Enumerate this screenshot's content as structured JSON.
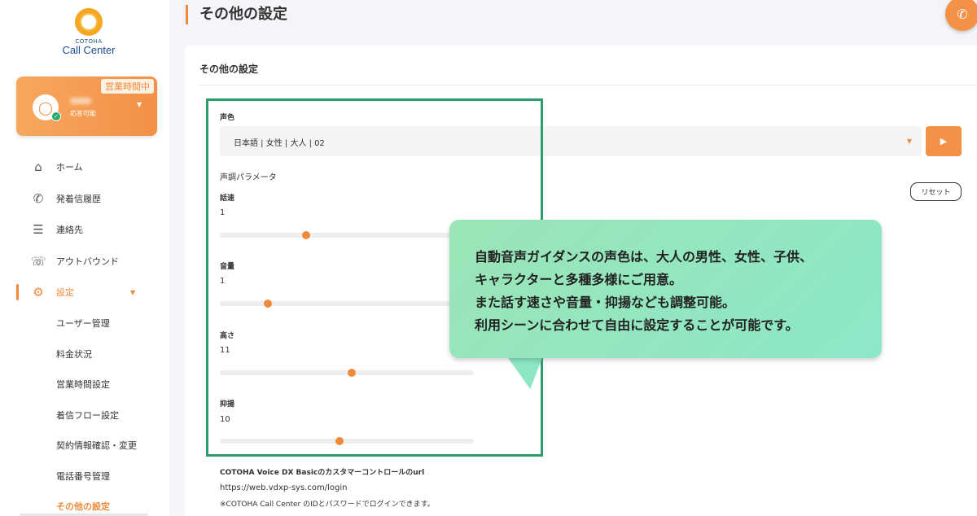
{
  "sidebar": {
    "logo": {
      "small": "COTOHA",
      "big": "Call Center"
    },
    "user": {
      "status_tag": "営業時間中",
      "availability": "応答可能"
    },
    "nav": [
      {
        "label": "ホーム",
        "icon": "home-icon"
      },
      {
        "label": "発着信履歴",
        "icon": "phone-history-icon"
      },
      {
        "label": "連絡先",
        "icon": "contacts-icon"
      },
      {
        "label": "アウトバウンド",
        "icon": "outbound-icon"
      },
      {
        "label": "設定",
        "icon": "gear-icon"
      }
    ],
    "settings_sub": [
      "ユーザー管理",
      "料金状況",
      "営業時間設定",
      "着信フロー設定",
      "契約情報確認・変更",
      "電話番号管理",
      "その他の設定"
    ]
  },
  "header": {
    "title": "その他の設定"
  },
  "card": {
    "title": "その他の設定",
    "voice_label": "声色",
    "voice_value": "日本語 | 女性 | 大人 | 02",
    "params_label": "声調パラメータ",
    "reset_label": "リセット",
    "params": [
      {
        "name": "話速",
        "value": "1",
        "level": 0.34
      },
      {
        "name": "音量",
        "value": "1",
        "level": 0.19
      },
      {
        "name": "高さ",
        "value": "11",
        "level": 0.52
      },
      {
        "name": "抑揚",
        "value": "10",
        "level": 0.47
      }
    ],
    "url_title": "COTOHA Voice DX Basicのカスタマーコントロールのurl",
    "url": "https://web.vdxp-sys.com/login",
    "url_note": "※COTOHA Call Center のIDとパスワードでログインできます。"
  },
  "callout": {
    "lines": [
      "自動音声ガイダンスの声色は、大人の男性、女性、子供、",
      "キャラクターと多種多様にご用意。",
      "また話す速さや音量・抑揚なども調整可能。",
      "利用シーンに合わせて自由に設定することが可能です。"
    ]
  },
  "colors": {
    "accent": "#f08a3b",
    "highlight_border": "#2e9d6e",
    "callout_bg": "#9be4b6"
  }
}
